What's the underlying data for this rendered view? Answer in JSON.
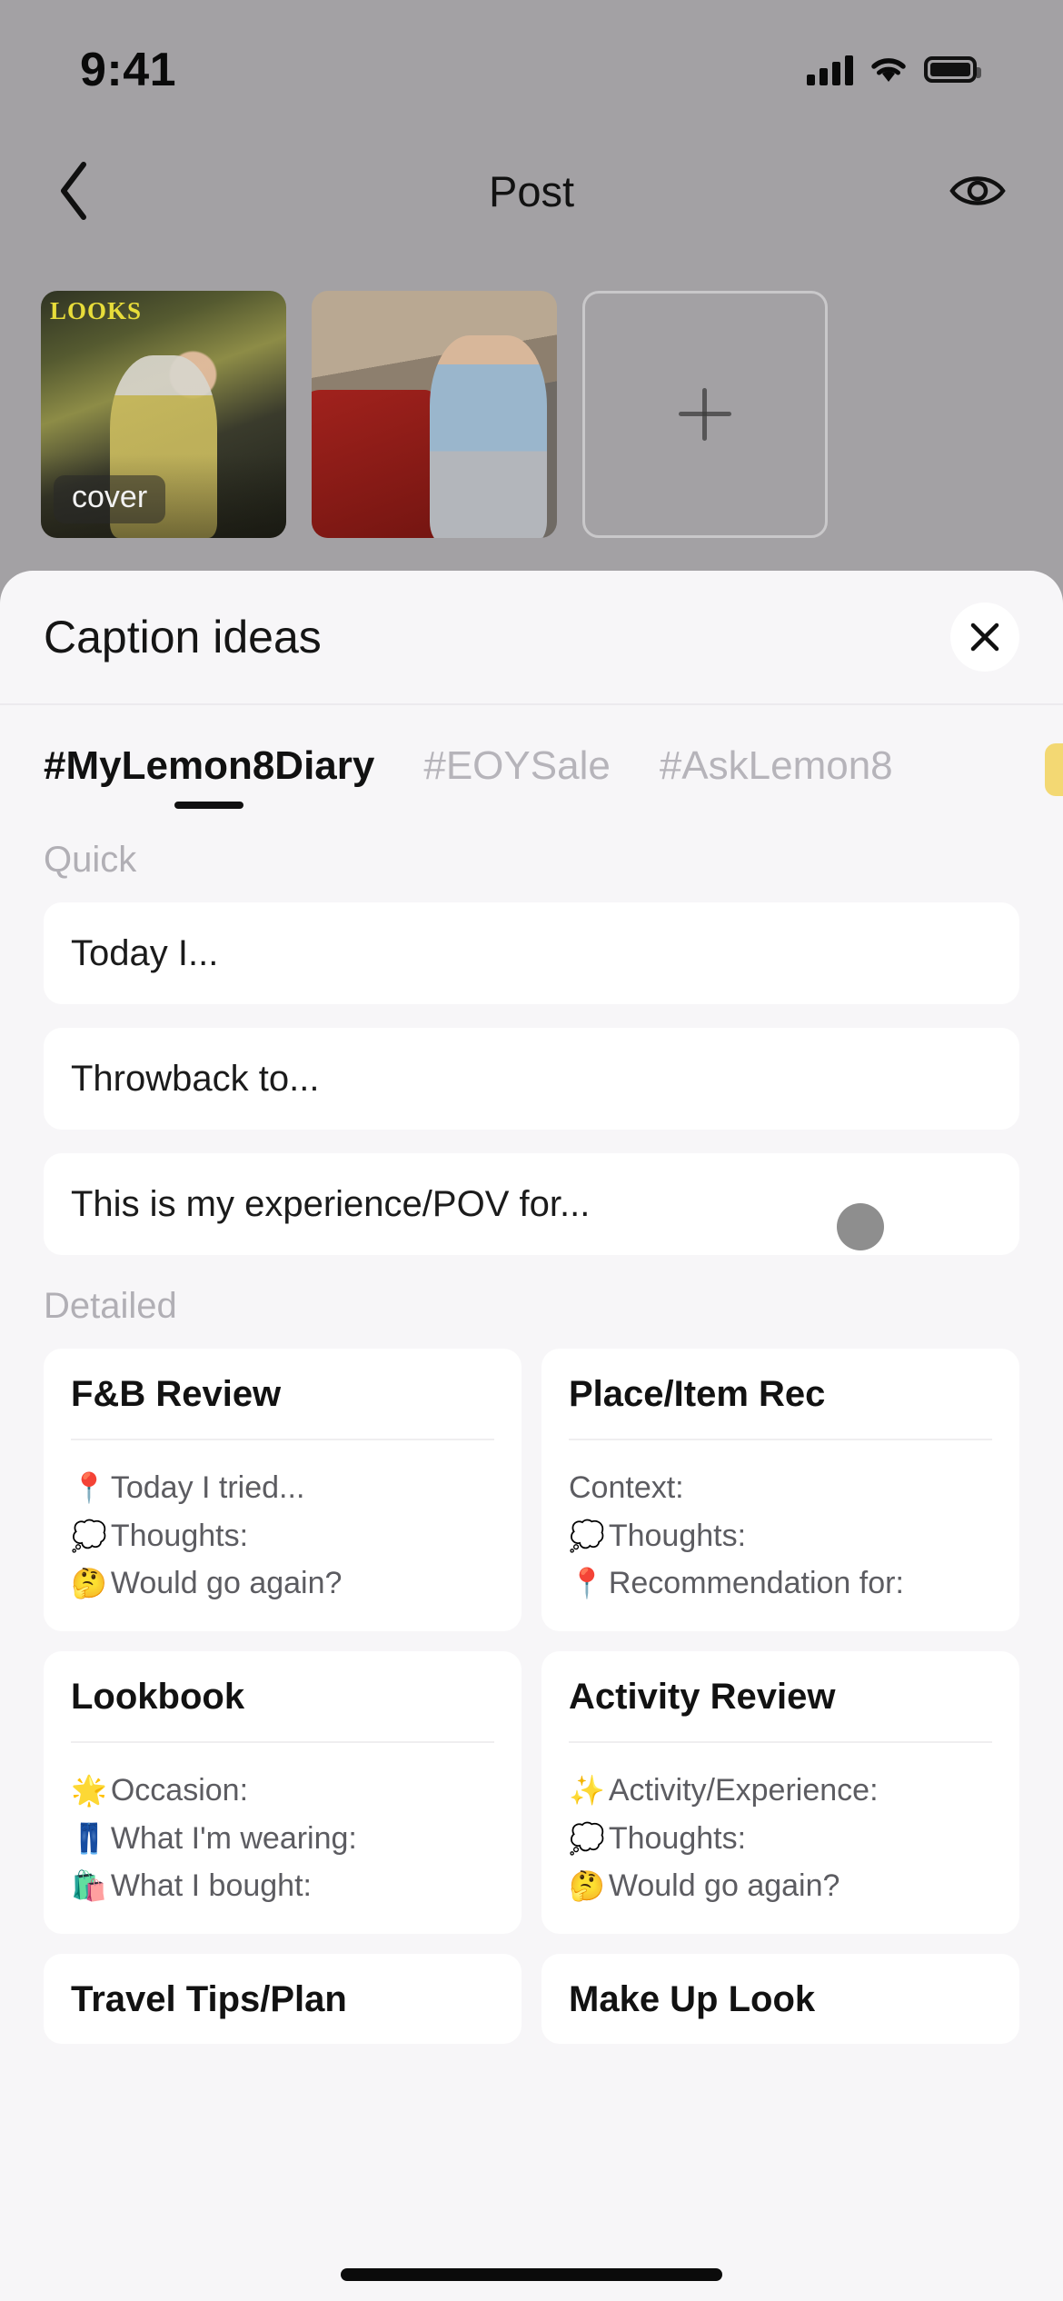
{
  "status_bar": {
    "time": "9:41",
    "icons": [
      "cellular-signal-icon",
      "wifi-icon",
      "battery-icon"
    ]
  },
  "nav": {
    "back_icon": "chevron-left-icon",
    "title": "Post",
    "preview_icon": "eye-icon"
  },
  "media": {
    "thumbnails": [
      {
        "label": "LOOKS",
        "badge": "cover"
      },
      {
        "label": "",
        "badge": ""
      }
    ],
    "add_label": "+"
  },
  "sheet": {
    "title": "Caption ideas",
    "close_icon": "close-icon",
    "tabs": [
      {
        "label": "#MyLemon8Diary",
        "active": true
      },
      {
        "label": "#EOYSale",
        "active": false
      },
      {
        "label": "#AskLemon8",
        "active": false
      }
    ],
    "quick": {
      "label": "Quick",
      "items": [
        "Today I...",
        "Throwback to...",
        "This is my experience/POV for..."
      ]
    },
    "detailed": {
      "label": "Detailed",
      "cards": [
        {
          "title": "F&B Review",
          "lines": [
            {
              "emoji": "📍",
              "text": "Today I tried..."
            },
            {
              "emoji": "💭",
              "text": "Thoughts:"
            },
            {
              "emoji": "🤔",
              "text": "Would go again?"
            }
          ]
        },
        {
          "title": "Place/Item Rec",
          "lines": [
            {
              "emoji": "",
              "text": "Context:"
            },
            {
              "emoji": "💭",
              "text": "Thoughts:"
            },
            {
              "emoji": "📍",
              "text": "Recommendation for:"
            }
          ]
        },
        {
          "title": "Lookbook",
          "lines": [
            {
              "emoji": "🌟",
              "text": "Occasion:"
            },
            {
              "emoji": "👖",
              "text": "What I'm wearing:"
            },
            {
              "emoji": "🛍️",
              "text": "What I bought:"
            }
          ]
        },
        {
          "title": "Activity Review",
          "lines": [
            {
              "emoji": "✨",
              "text": "Activity/Experience:"
            },
            {
              "emoji": "💭",
              "text": "Thoughts:"
            },
            {
              "emoji": "🤔",
              "text": "Would go again?"
            }
          ]
        },
        {
          "title": "Travel Tips/Plan",
          "lines": []
        },
        {
          "title": "Make Up Look",
          "lines": []
        }
      ]
    }
  },
  "colors": {
    "sheet_bg": "#f7f6f8",
    "card_bg": "#ffffff",
    "accent": "#111111",
    "muted": "#b1afb5",
    "backdrop": "#a3a1a4"
  }
}
